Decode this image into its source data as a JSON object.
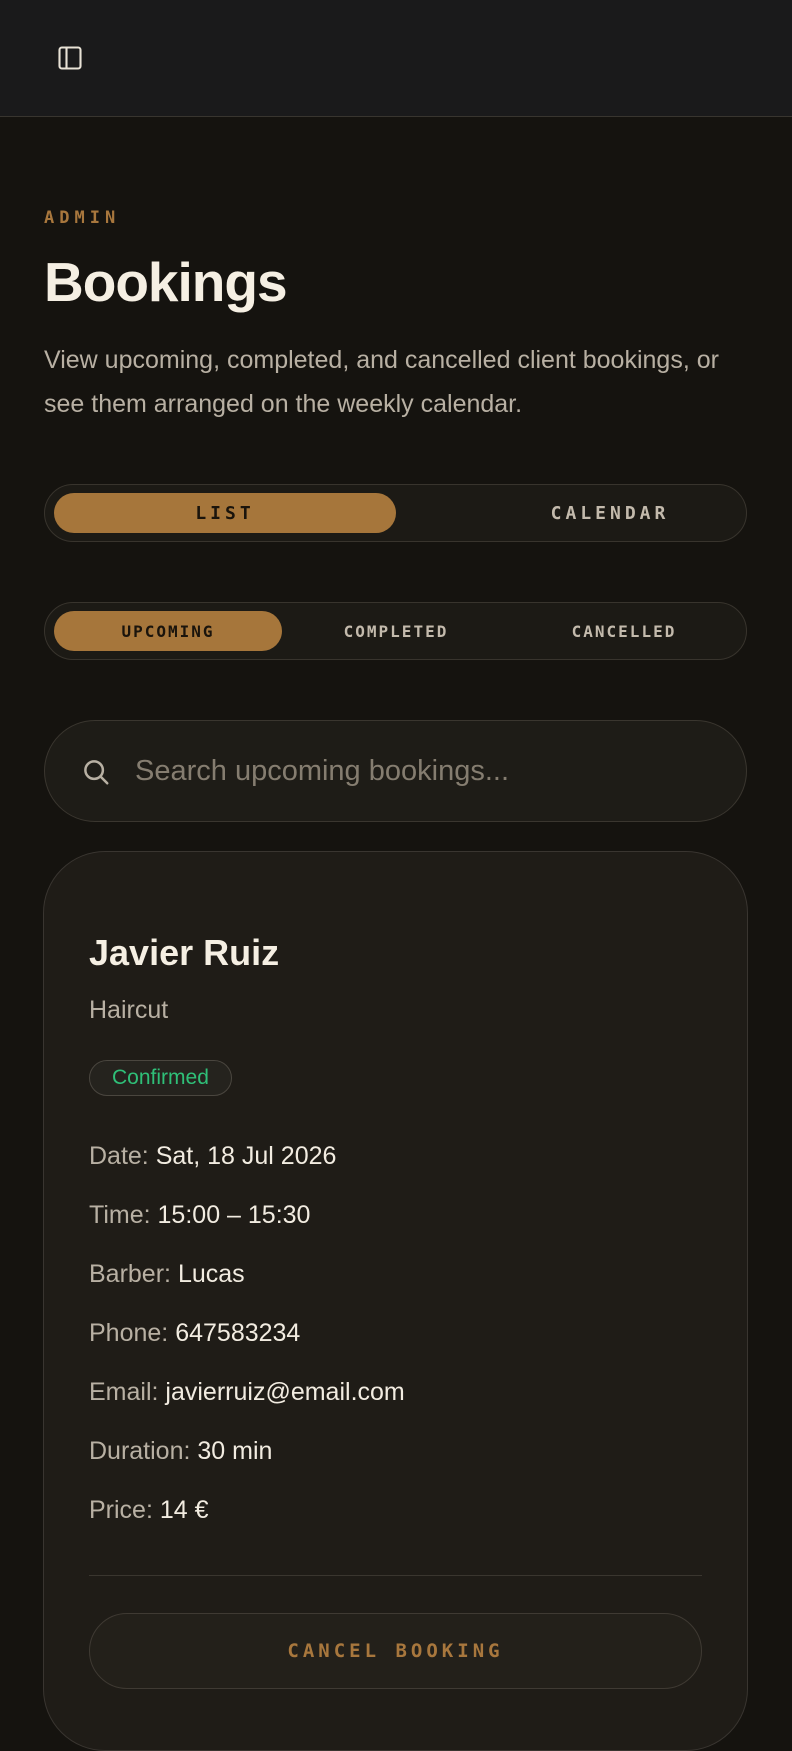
{
  "header": {
    "sidebar_toggle_icon": "sidebar-panel-icon"
  },
  "page": {
    "eyebrow": "ADMIN",
    "title": "Bookings",
    "description": "View upcoming, completed, and cancelled client bookings, or see them arranged on the weekly calendar."
  },
  "view_toggle": {
    "options": [
      "LIST",
      "CALENDAR"
    ],
    "selected": "LIST"
  },
  "status_tabs": {
    "options": [
      "UPCOMING",
      "COMPLETED",
      "CANCELLED"
    ],
    "selected": "UPCOMING"
  },
  "search": {
    "placeholder": "Search upcoming bookings...",
    "value": "",
    "icon": "search-icon"
  },
  "booking": {
    "client_name": "Javier Ruiz",
    "service": "Haircut",
    "status": "Confirmed",
    "details": [
      {
        "label": "Date:",
        "value": "Sat, 18 Jul 2026"
      },
      {
        "label": "Time:",
        "value": "15:00 – 15:30"
      },
      {
        "label": "Barber:",
        "value": "Lucas"
      },
      {
        "label": "Phone:",
        "value": "647583234"
      },
      {
        "label": "Email:",
        "value": "javierruiz@email.com"
      },
      {
        "label": "Duration:",
        "value": "30 min"
      },
      {
        "label": "Price:",
        "value": "14 €"
      }
    ],
    "cancel_label": "CANCEL BOOKING"
  },
  "colors": {
    "accent": "#a6763b",
    "status_confirmed": "#2fbf78",
    "background": "#15130f",
    "card": "#1f1c17"
  }
}
